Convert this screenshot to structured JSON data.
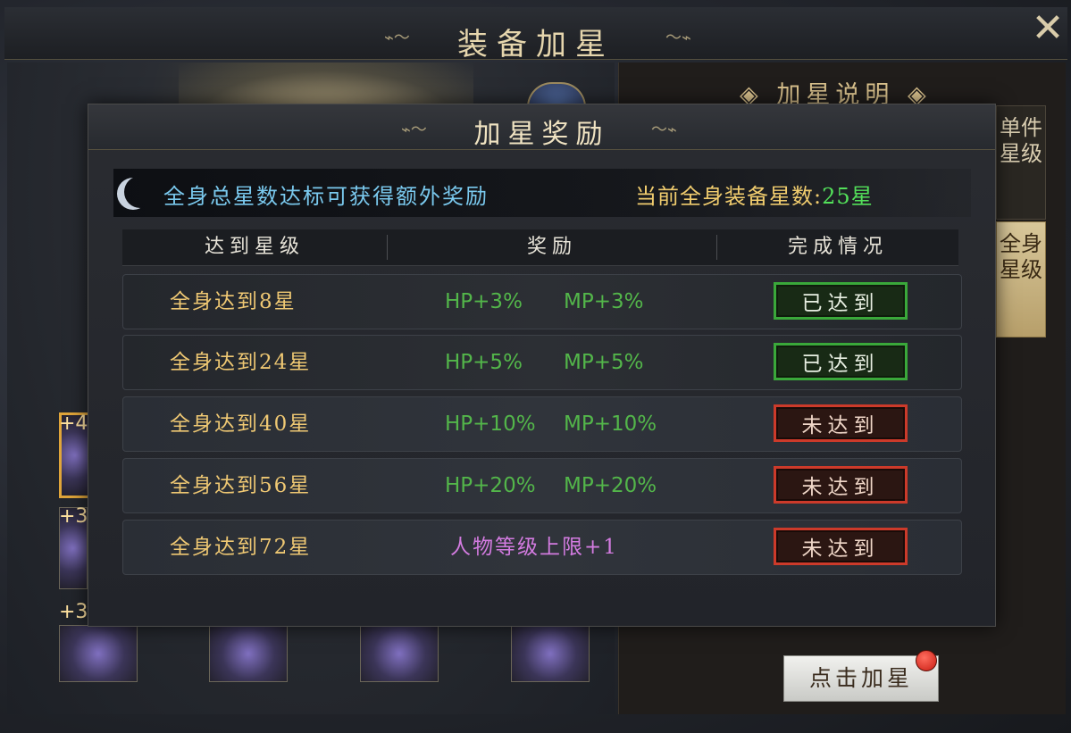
{
  "background": {
    "title": "装备加星",
    "explain_title": "加星说明",
    "tabs": [
      "单件星级",
      "全身星级"
    ],
    "slot_tags": [
      "+4",
      "+3",
      "+3"
    ],
    "action_button": "点击加星"
  },
  "dialog": {
    "title": "加星奖励",
    "banner_text": "全身总星数达标可获得额外奖励",
    "current_stars_label": "当前全身装备星数:",
    "current_stars_value": "25星",
    "headers": [
      "达到星级",
      "奖励",
      "完成情况"
    ],
    "rows": [
      {
        "requirement": "全身达到8星",
        "hp": "HP+3%",
        "mp": "MP+3%",
        "status": "已达到"
      },
      {
        "requirement": "全身达到24星",
        "hp": "HP+5%",
        "mp": "MP+5%",
        "status": "已达到"
      },
      {
        "requirement": "全身达到40星",
        "hp": "HP+10%",
        "mp": "MP+10%",
        "status": "未达到"
      },
      {
        "requirement": "全身达到56星",
        "hp": "HP+20%",
        "mp": "MP+20%",
        "status": "未达到"
      },
      {
        "requirement": "全身达到72星",
        "reward": "人物等级上限+1",
        "status": "未达到"
      }
    ]
  },
  "colors": {
    "achieved": "#3aa83a",
    "not_achieved": "#cc3a2a",
    "gold_text": "#efc873",
    "green_text": "#53b64a",
    "purple_text": "#d37be0",
    "banner_blue": "#7ac9ee"
  }
}
